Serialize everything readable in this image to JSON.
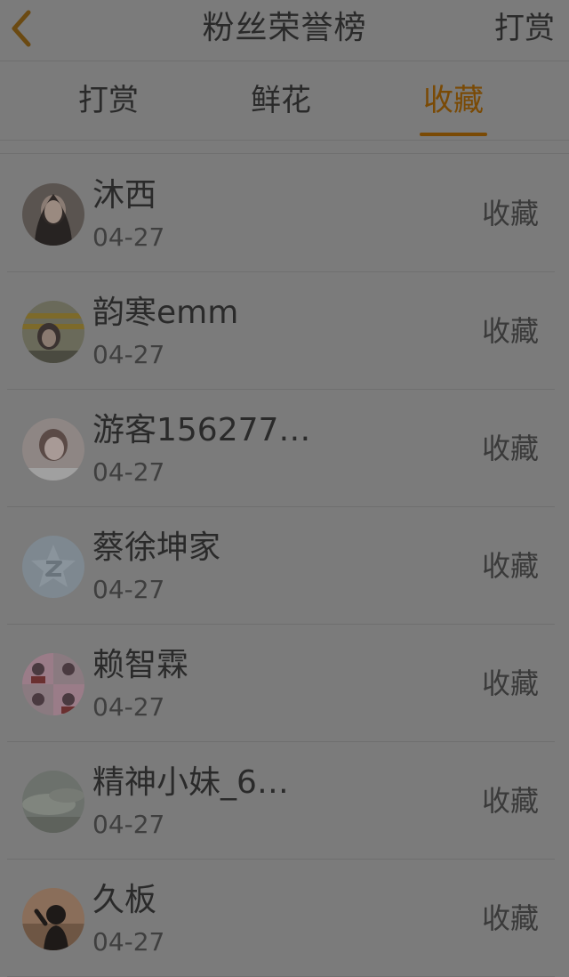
{
  "header": {
    "title": "粉丝荣誉榜",
    "action_label": "打赏",
    "back_icon": "chevron-left-icon",
    "accent_color": "#7a4a05"
  },
  "tabs": [
    {
      "label": "打赏"
    },
    {
      "label": "鲜花"
    },
    {
      "label": "收藏",
      "active": true
    }
  ],
  "list": [
    {
      "name": "沐西",
      "date": "04-27",
      "action": "收藏"
    },
    {
      "name": "韵寒emm",
      "date": "04-27",
      "action": "收藏"
    },
    {
      "name": "游客156277…",
      "date": "04-27",
      "action": "收藏"
    },
    {
      "name": "蔡徐坤家",
      "date": "04-27",
      "action": "收藏"
    },
    {
      "name": "赖智霖",
      "date": "04-27",
      "action": "收藏"
    },
    {
      "name": "精神小妹_6…",
      "date": "04-27",
      "action": "收藏"
    },
    {
      "name": "久板",
      "date": "04-27",
      "action": "收藏"
    }
  ]
}
